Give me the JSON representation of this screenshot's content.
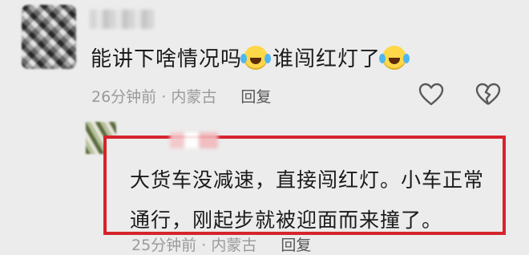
{
  "comment": {
    "text_part1": "能讲下啥情况吗",
    "emoji1": "grinning-tears-emoji",
    "text_part2": "谁闯红灯了",
    "emoji2": "grinning-tears-emoji",
    "time": "26分钟前",
    "separator": "·",
    "location": "内蒙古",
    "reply_label": "回复"
  },
  "reply": {
    "text": "大货车没减速，直接闯红灯。小车正常通行，刚起步就被迎面而来撞了。",
    "time": "25分钟前",
    "separator": "·",
    "location": "内蒙古",
    "reply_label": "回复"
  },
  "colors": {
    "highlight_border": "#d6242c",
    "background": "#ececec",
    "meta_text": "#9a9a9a"
  }
}
